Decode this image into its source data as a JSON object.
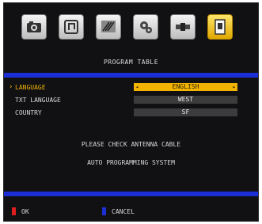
{
  "tabs": [
    {
      "name": "picture-tab",
      "icon": "camera-icon",
      "active": false
    },
    {
      "name": "sound-tab",
      "icon": "music-note-icon",
      "active": false
    },
    {
      "name": "screen-tab",
      "icon": "tv-stripes-icon",
      "active": false
    },
    {
      "name": "setup-tab",
      "icon": "gears-icon",
      "active": false
    },
    {
      "name": "connection-tab",
      "icon": "cable-icon",
      "active": false
    },
    {
      "name": "program-tab",
      "icon": "document-icon",
      "active": true
    }
  ],
  "title": "PROGRAM TABLE",
  "rows": [
    {
      "label": "LANGUAGE",
      "value": "ENGLISH",
      "selected": true
    },
    {
      "label": "TXT LANGUAGE",
      "value": "WEST",
      "selected": false
    },
    {
      "label": "COUNTRY",
      "value": "SF",
      "selected": false
    }
  ],
  "messages": [
    "PLEASE CHECK ANTENNA CABLE",
    "AUTO PROGRAMMING SYSTEM"
  ],
  "footer": {
    "ok_label": "OK",
    "cancel_label": "CANCEL",
    "ok_color": "#e01e1e",
    "cancel_color": "#1c2fd6"
  },
  "colors": {
    "accent": "#f2b400",
    "bar": "#1c2fd6",
    "background": "#111114"
  }
}
